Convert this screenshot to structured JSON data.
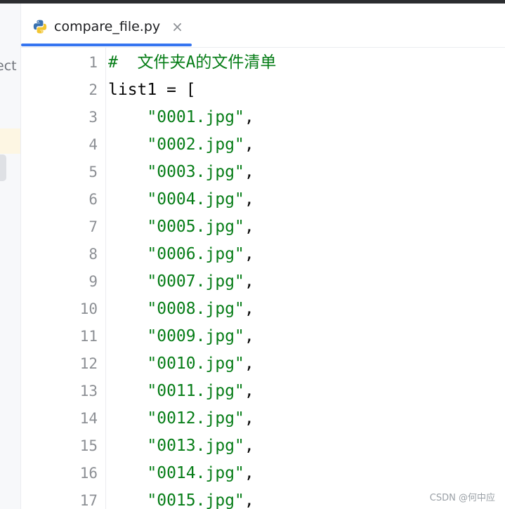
{
  "side_panel": {
    "label": "ect"
  },
  "tab": {
    "label": "compare_file.py",
    "close_glyph": "×",
    "icon": "python-icon"
  },
  "editor": {
    "line_numbers": [
      "1",
      "2",
      "3",
      "4",
      "5",
      "6",
      "7",
      "8",
      "9",
      "10",
      "11",
      "12",
      "13",
      "14",
      "15",
      "16",
      "17"
    ],
    "comment": "#  文件夹A的文件清单",
    "decl": "list1 = [",
    "items": [
      "\"0001.jpg\"",
      "\"0002.jpg\"",
      "\"0003.jpg\"",
      "\"0004.jpg\"",
      "\"0005.jpg\"",
      "\"0006.jpg\"",
      "\"0007.jpg\"",
      "\"0008.jpg\"",
      "\"0009.jpg\"",
      "\"0010.jpg\"",
      "\"0011.jpg\"",
      "\"0012.jpg\"",
      "\"0013.jpg\"",
      "\"0014.jpg\"",
      "\"0015.jpg\""
    ],
    "item_suffix": ","
  },
  "watermark": "CSDN @何中应",
  "colors": {
    "accent": "#3574f0",
    "string": "#067d17",
    "line_number": "#8c8f94"
  }
}
